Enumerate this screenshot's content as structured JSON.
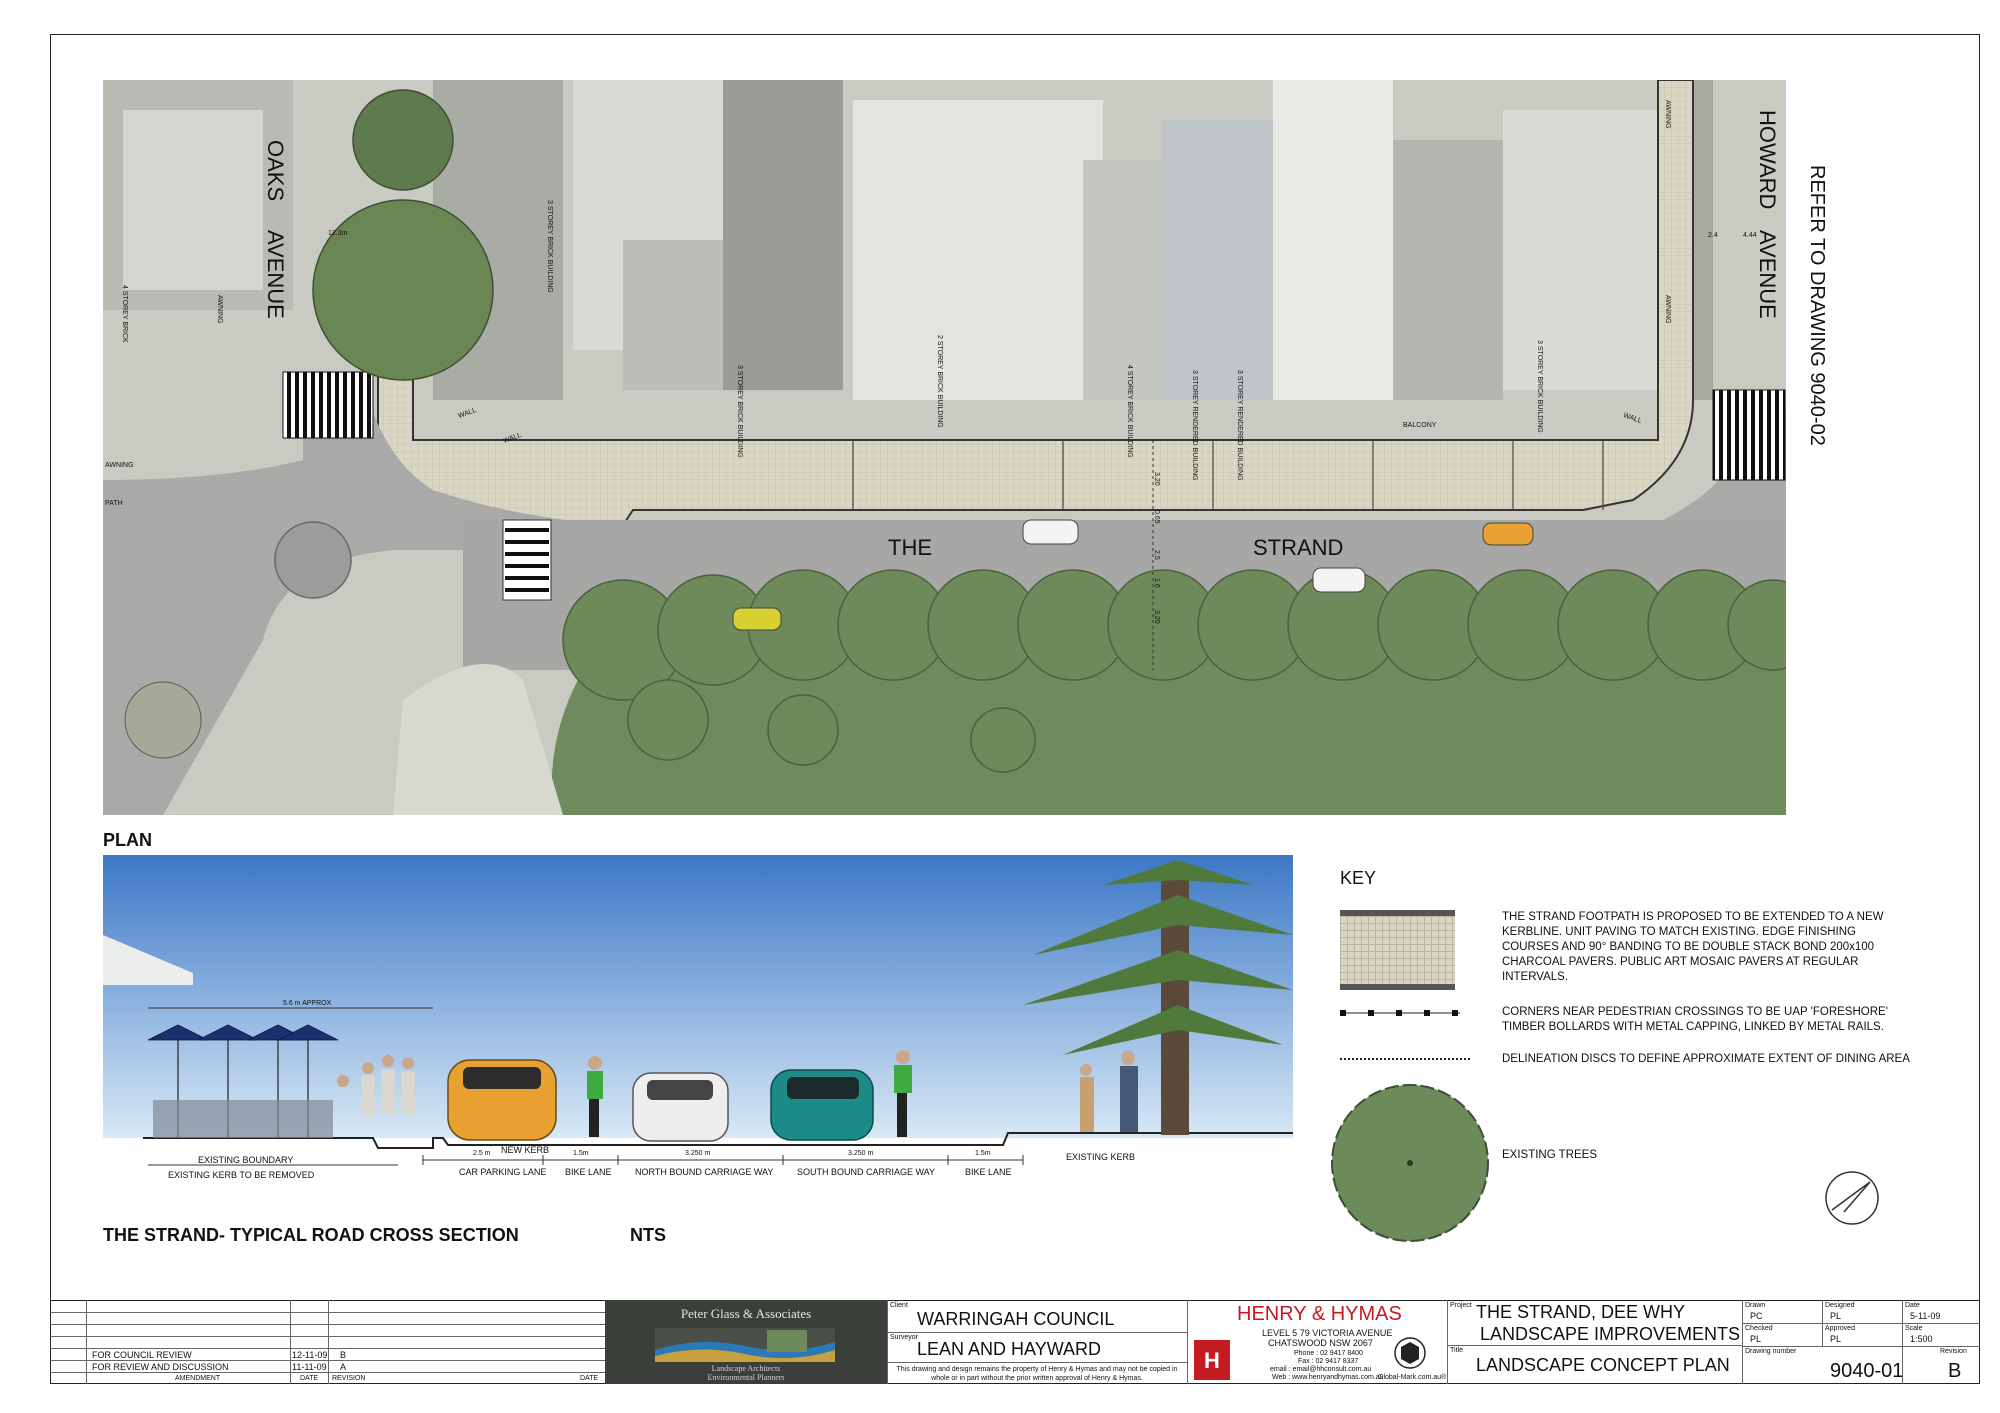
{
  "plan": {
    "label": "PLAN",
    "street_labels": [
      "OAKS",
      "AVENUE",
      "HOWARD",
      "AVENUE",
      "THE",
      "STRAND"
    ],
    "refer_note": "REFER TO DRAWING 9040-02",
    "building_labels": [
      "4 STOREY BRICK",
      "AWNING",
      "3 STOREY BRICK BUILDING",
      "3 STOREY BRICK BUILDING",
      "2 STOREY BRICK BUILDING",
      "4 STOREY BRICK BUILDING",
      "3 STOREY RENDERED BUILDING",
      "3 STOREY RENDERED BUILDING",
      "3 STOREY BRICK BUILDING",
      "AWNING",
      "AWNING",
      "BALCONY",
      "WALL",
      "WALL",
      "WALL",
      "AWNING",
      "PATH"
    ],
    "dimension_labels": [
      "12.3m",
      "2.4",
      "4.44",
      "2.5",
      "1.6",
      "3.20",
      "3.20",
      "0.65"
    ]
  },
  "section": {
    "title": "THE STRAND- TYPICAL ROAD CROSS SECTION",
    "scale_note": "NTS",
    "dimension_top": "5.6 m APPROX",
    "dimensions": [
      "2.5 m",
      "1.5m",
      "3.250 m",
      "3.250 m",
      "1.5m"
    ],
    "lane_labels": [
      "CAR PARKING LANE",
      "BIKE LANE",
      "NORTH BOUND CARRIAGE WAY",
      "SOUTH BOUND CARRIAGE WAY",
      "BIKE LANE"
    ],
    "annotations": [
      "EXISTING BOUNDARY",
      "EXISTING KERB TO BE REMOVED",
      "NEW KERB",
      "EXISTING KERB"
    ]
  },
  "key": {
    "title": "KEY",
    "items": [
      {
        "symbol": "paving-swatch",
        "text": "THE STRAND FOOTPATH IS PROPOSED TO BE EXTENDED TO A NEW KERBLINE. UNIT PAVING TO MATCH EXISTING. EDGE FINISHING COURSES AND 90° BANDING TO BE DOUBLE STACK BOND 200x100 CHARCOAL PAVERS. PUBLIC ART MOSAIC PAVERS AT REGULAR INTERVALS."
      },
      {
        "symbol": "bollard-line",
        "text": "CORNERS NEAR PEDESTRIAN CROSSINGS TO BE UAP 'FORESHORE' TIMBER BOLLARDS WITH METAL CAPPING, LINKED BY METAL RAILS."
      },
      {
        "symbol": "dotted-line",
        "text": "DELINEATION DISCS TO DEFINE APPROXIMATE EXTENT OF DINING AREA"
      },
      {
        "symbol": "tree-circle",
        "text": "EXISTING TREES"
      }
    ]
  },
  "title_block": {
    "revisions": [
      {
        "amendment": "FOR COUNCIL REVIEW",
        "date": "12-11-09",
        "revision": "B"
      },
      {
        "amendment": "FOR REVIEW AND DISCUSSION",
        "date": "11-11-09",
        "revision": "A"
      }
    ],
    "revision_headers": [
      "AMENDMENT",
      "DATE",
      "REVISION",
      "DATE"
    ],
    "consultant": {
      "name": "Peter Glass & Associates",
      "line1": "Landscape Architects",
      "line2": "Environmental Planners"
    },
    "client_label": "Client",
    "client": "WARRINGAH COUNCIL",
    "surveyor_label": "Surveyor",
    "surveyor": "LEAN AND HAYWARD",
    "copyright": "This drawing and design remains the property of Henry & Hymas and may not be copied in whole or in part without the prior written approval of Henry & Hymas.",
    "firm": {
      "name": "HENRY & HYMAS",
      "address1": "LEVEL 5  79 VICTORIA AVENUE",
      "address2": "CHATSWOOD  NSW  2067",
      "phone": "Phone : 02 9417 8400",
      "fax": "Fax : 02 9417 8337",
      "email": "email : email@hhconsult.com.au",
      "web": "Web : www.henryandhymas.com.au",
      "cert": "Global-Mark.com.au®"
    },
    "project_label": "Project",
    "project_line1": "THE STRAND, DEE WHY",
    "project_line2": "LANDSCAPE IMPROVEMENTS",
    "title_label": "Title",
    "drawing_title": "LANDSCAPE CONCEPT PLAN",
    "drawn_label": "Drawn",
    "drawn": "PC",
    "designed_label": "Designed",
    "designed": "PL",
    "date_label": "Date",
    "date": "5-11-09",
    "checked_label": "Checked",
    "checked": "PL",
    "approved_label": "Approved",
    "approved": "PL",
    "scale_label": "Scale",
    "scale": "1:500",
    "drawing_number_label": "Drawing number",
    "drawing_number": "9040-01",
    "revision_label": "Revision",
    "revision": "B"
  },
  "colors": {
    "footpath": "#d8d6c2",
    "road": "#a8a9a6",
    "tree": "#6d8a5a",
    "grass": "#cfd6c4",
    "sky_top": "#3c78c6",
    "sky_bottom": "#d8e8f6",
    "hh_red": "#c41a24"
  }
}
